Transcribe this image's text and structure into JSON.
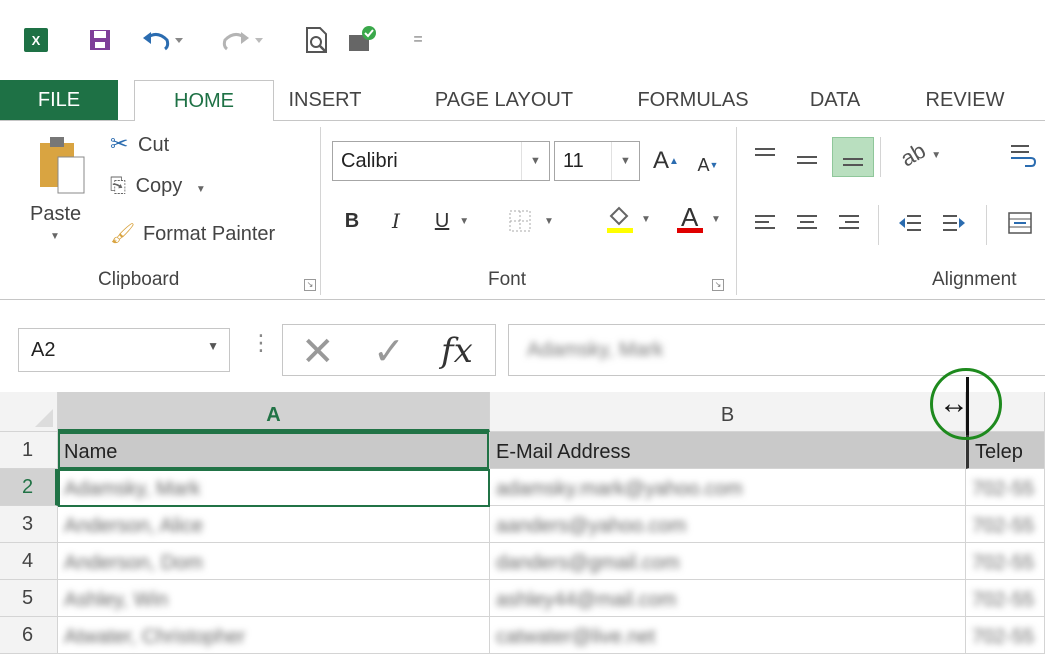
{
  "qat": {
    "app_logo": "X",
    "more": "="
  },
  "tabs": {
    "file": "FILE",
    "home": "HOME",
    "insert": "INSERT",
    "page_layout": "PAGE LAYOUT",
    "formulas": "FORMULAS",
    "data": "DATA",
    "review": "REVIEW"
  },
  "clipboard": {
    "paste": "Paste",
    "cut": "Cut",
    "copy": "Copy",
    "format_painter": "Format Painter",
    "group_label": "Clipboard"
  },
  "font": {
    "name": "Calibri",
    "size": "11",
    "bold": "B",
    "italic": "I",
    "underline": "U",
    "font_color_glyph": "A",
    "grow_glyph": "A",
    "shrink_glyph": "A",
    "group_label": "Font"
  },
  "alignment": {
    "group_label": "Alignment"
  },
  "formula_bar": {
    "name_box": "A2",
    "fx": "fx",
    "value": "Adamsky, Mark"
  },
  "grid": {
    "columns": [
      "A",
      "B"
    ],
    "header_row": {
      "row": "1",
      "a": "Name",
      "b": "E-Mail Address",
      "c": "Telep"
    },
    "rows": [
      {
        "row": "2",
        "a": "Adamsky, Mark",
        "b": "adamsky.mark@yahoo.com",
        "c": "702-55"
      },
      {
        "row": "3",
        "a": "Anderson, Alice",
        "b": "aanders@yahoo.com",
        "c": "702-55"
      },
      {
        "row": "4",
        "a": "Anderson, Dom",
        "b": "danders@gmail.com",
        "c": "702-55"
      },
      {
        "row": "5",
        "a": "Ashley, Win",
        "b": "ashley44@mail.com",
        "c": "702-55"
      },
      {
        "row": "6",
        "a": "Atwater, Christopher",
        "b": "catwater@live.net",
        "c": "702-55"
      }
    ]
  },
  "colors": {
    "excel_green": "#217346",
    "file_tab": "#1e7145",
    "highlight_ring": "#1e8a1e"
  }
}
